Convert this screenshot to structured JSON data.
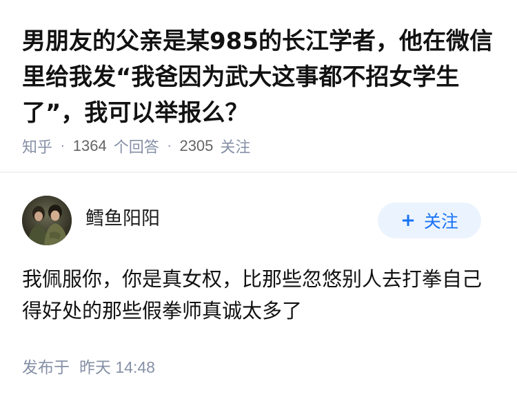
{
  "question": {
    "title": "男朋友的父亲是某985的长江学者，他在微信里给我发“我爸因为武大这事都不招女学生了”，我可以举报么？",
    "source": "知乎",
    "answer_count": "1364",
    "answer_label": "个回答",
    "follower_count": "2305",
    "follower_label": "关注"
  },
  "answer": {
    "author_name": "鳕鱼阳阳",
    "follow_label": "关注",
    "follow_plus": "+",
    "content": "我佩服你，你是真女权，比那些忽悠别人去打拳自己得好处的那些假拳师真诚太多了",
    "time_prefix": "发布于",
    "time": "昨天 14:48"
  },
  "colors": {
    "accent": "#1772f6",
    "follow_bg": "#ebf4fe",
    "meta_gray": "#8590a6"
  }
}
